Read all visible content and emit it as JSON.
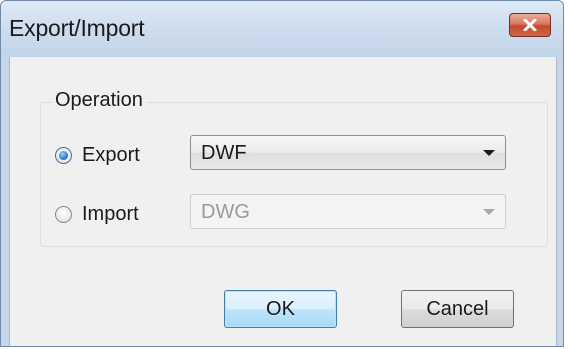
{
  "window": {
    "title": "Export/Import",
    "close_icon": "close-icon"
  },
  "operation": {
    "group_label": "Operation",
    "export": {
      "label": "Export",
      "selected": true,
      "format_value": "DWF",
      "enabled": true
    },
    "import": {
      "label": "Import",
      "selected": false,
      "format_value": "DWG",
      "enabled": false
    }
  },
  "buttons": {
    "ok_label": "OK",
    "cancel_label": "Cancel"
  },
  "colors": {
    "titlebar": "#c2d4e8",
    "close_button": "#c24a30",
    "default_button_border": "#3c7fb1"
  }
}
